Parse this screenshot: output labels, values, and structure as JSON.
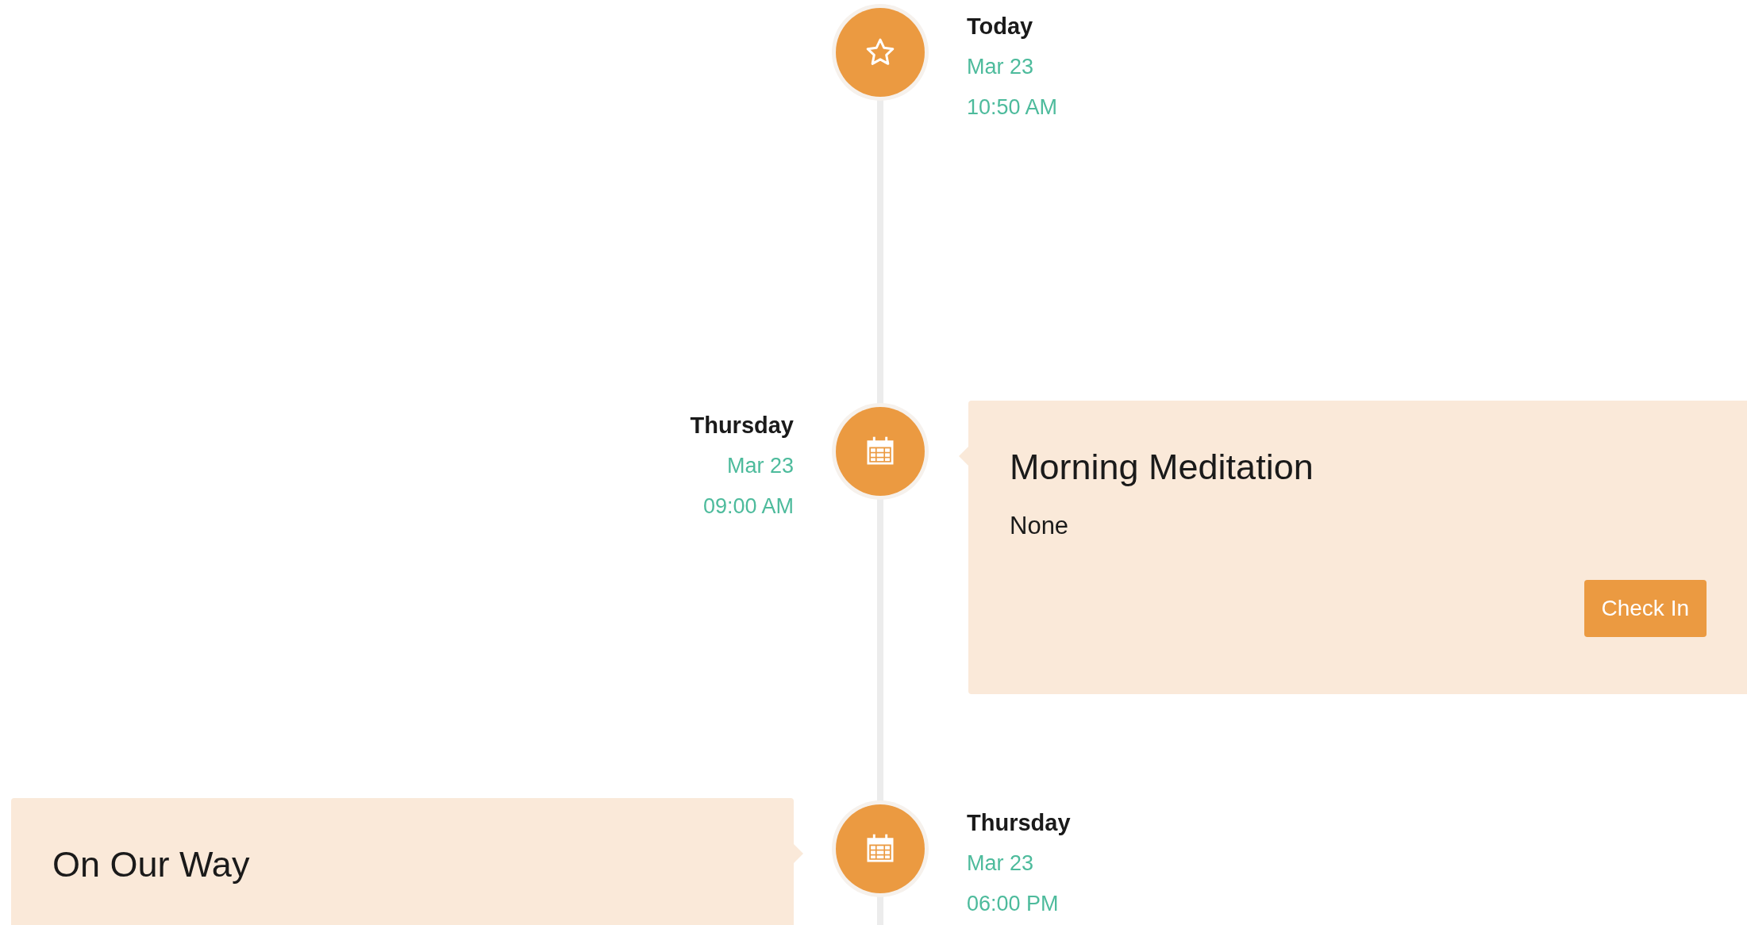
{
  "timeline": [
    {
      "kind": "milestone",
      "labels_on_left": false,
      "day": "Today",
      "date": "Mar 23",
      "time": "10:50 AM"
    },
    {
      "kind": "event",
      "labels_on_left": true,
      "day": "Thursday",
      "date": "Mar 23",
      "time": "09:00 AM",
      "card": {
        "title": "Morning Meditation",
        "note": "None",
        "button": "Check In"
      }
    },
    {
      "kind": "event",
      "labels_on_left": false,
      "day": "Thursday",
      "date": "Mar 23",
      "time": "06:00 PM",
      "card": {
        "title": "On Our Way"
      }
    }
  ]
}
